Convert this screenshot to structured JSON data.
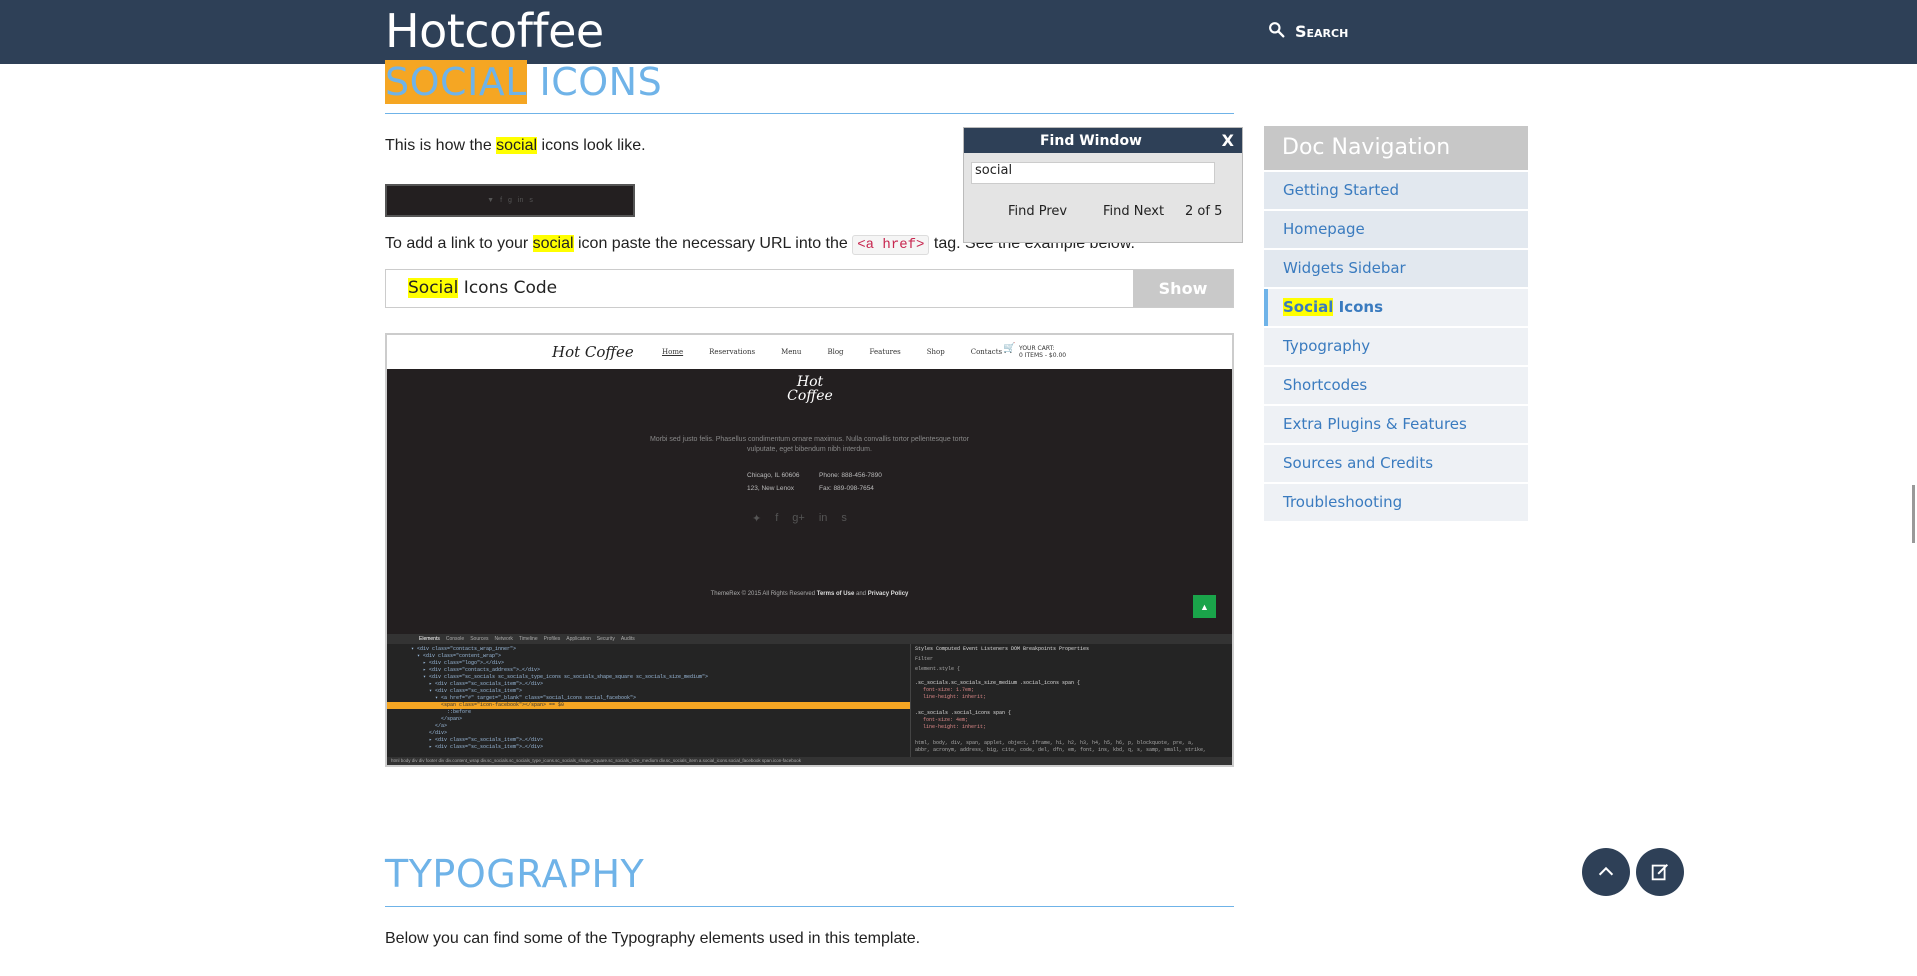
{
  "header": {
    "brand": "Hotcoffee",
    "search_label": "Search"
  },
  "section_social": {
    "title_highlight": "SOCIAL",
    "title_rest": " ICONS",
    "intro_before": "This is how the ",
    "intro_highlight": "social",
    "intro_after": " icons look like.",
    "link_before": "To add a link to your ",
    "link_highlight": "social",
    "link_middle": " icon paste the necessary URL into the ",
    "link_code": "<a href>",
    "link_after": " tag. See the example below.",
    "code_bar_highlight": "Social",
    "code_bar_rest": " Icons Code",
    "show_label": "Show"
  },
  "preview": {
    "logo": "Hot Coffee",
    "menu": [
      "Home",
      "Reservations",
      "Menu",
      "Blog",
      "Features",
      "Shop",
      "Contacts"
    ],
    "cart_line1": "YOUR CART:",
    "cart_line2": "0 ITEMS - $0.00",
    "footer_logo": "Hot Coffee",
    "description": "Morbi sed justo felis. Phasellus condimentum ornare maximus. Nulla convallis tortor pellentesque tortor vulputate, eget bibendum nibh interdum.",
    "address1": "Chicago, IL 60606",
    "address2": "123, New Lenox",
    "phone": "Phone: 888-456-7890",
    "fax": "Fax: 889-098-7654",
    "copy_before": "ThemeRex © 2015 All Rights Reserved ",
    "terms": "Terms of Use",
    "copy_and": " and ",
    "privacy": "Privacy Policy",
    "devtools_tabs": [
      "Elements",
      "Console",
      "Sources",
      "Network",
      "Timeline",
      "Profiles",
      "Application",
      "Security",
      "Audits"
    ],
    "devtools_right_tabs": "Styles  Computed  Event Listeners  DOM Breakpoints  Properties",
    "devtools_breadcrumb": "html  body  div  div  footer  div  div.content_wrap  div.sc_socials.sc_socials_type_icons.sc_socials_shape_square.sc_socials_size_medium  div.sc_socials_item  a.social_icons.social_facebook  span.icon-facebook"
  },
  "find_window": {
    "title": "Find Window",
    "close": "X",
    "query": "social",
    "prev": "Find Prev",
    "next": "Find Next",
    "count": "2 of 5"
  },
  "docnav": {
    "title": "Doc Navigation",
    "items": [
      {
        "label": "Getting Started"
      },
      {
        "label": "Homepage"
      },
      {
        "label": "Widgets Sidebar"
      },
      {
        "label_highlight": "Social",
        "label_rest": " Icons"
      },
      {
        "label": "Typography"
      },
      {
        "label": "Shortcodes"
      },
      {
        "label": "Extra Plugins & Features"
      },
      {
        "label": "Sources and Credits"
      },
      {
        "label": "Troubleshooting"
      }
    ]
  },
  "section_typography": {
    "title": "TYPOGRAPHY",
    "intro": "Below you can find some of the Typography elements used in this template."
  },
  "colors": {
    "header_bg": "#2e4057",
    "accent_blue": "#6fb3e8",
    "highlight_current": "#f5a623",
    "highlight_match": "#ffff00"
  },
  "icons": [
    "search-icon",
    "chevron-up-icon",
    "edit-note-icon"
  ]
}
